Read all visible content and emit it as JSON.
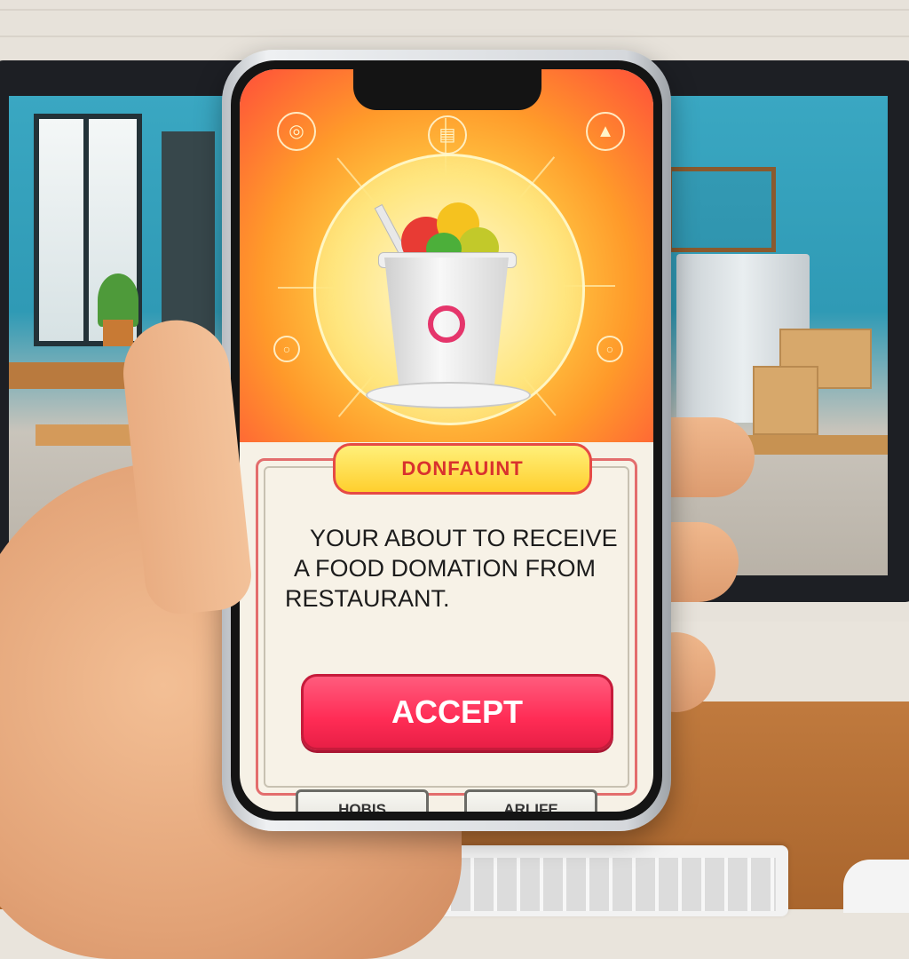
{
  "notification": {
    "banner_title": "DONFAUINT",
    "message_lines": [
      "YOUR ABOUT TO RECEIVE",
      "A  FOOD DOMATION FROM",
      "RESTAURANT."
    ],
    "accept_label": "ACCEPT",
    "secondary_buttons": [
      "HOBIS",
      "ARLIFE"
    ]
  },
  "colors": {
    "accent": "#ff2c55",
    "banner_bg": "#ffd83a",
    "banner_text": "#d9322e",
    "hero_gradient_start": "#fff6c8",
    "hero_gradient_end": "#ff4f3a",
    "card_bg": "#f7f2e7"
  },
  "icons": {
    "hero_illustration": "food-cup-icon",
    "hero_decor": [
      "apple-icon",
      "calendar-icon",
      "chart-icon",
      "ring-icon"
    ]
  }
}
